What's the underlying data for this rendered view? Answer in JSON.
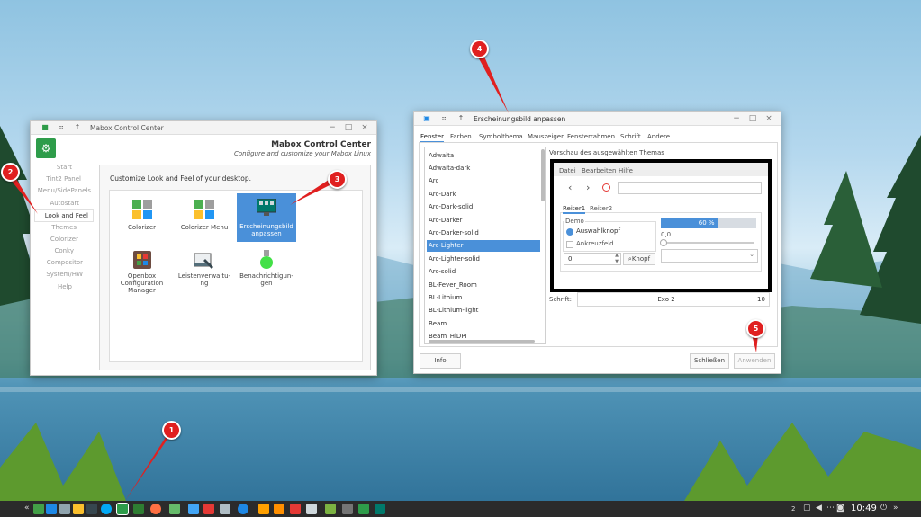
{
  "colors": {
    "accent": "#4a90d9",
    "marker": "#e02020",
    "taskbar": "#2b2b2b"
  },
  "mcc": {
    "title": "Mabox Control Center",
    "header_title": "Mabox Control Center",
    "header_subtitle": "Configure and customize your Mabox Linux",
    "sidebar": [
      "Start",
      "Tint2 Panel",
      "Menu/SidePanels",
      "Autostart",
      "Look and Feel",
      "Themes",
      "Colorizer",
      "Conky",
      "Compositor",
      "System/HW",
      "Help"
    ],
    "content_heading": "Customize Look and Feel of your desktop.",
    "tiles": [
      {
        "label": "Colorizer",
        "icon": "colorizer-icon"
      },
      {
        "label": "Colorizer Menu",
        "icon": "colorizer-menu-icon"
      },
      {
        "label": "Erscheinungsbild anpassen",
        "line1": "Erscheinungsbild",
        "line2": "anpassen",
        "icon": "appearance-icon"
      },
      {
        "label": "Openbox Configuration Manager",
        "line1": "Openbox",
        "line2": "Configuration",
        "line3": "Manager",
        "icon": "openbox-icon"
      },
      {
        "label": "Leistenverwaltung",
        "line1": "Leistenverwaltu-",
        "line2": "ng",
        "icon": "panel-manager-icon"
      },
      {
        "label": "Benachrichtigungen",
        "line1": "Benachrichtigun-",
        "line2": "gen",
        "icon": "notification-icon"
      }
    ],
    "window_controls": {
      "minimize": "−",
      "maximize": "□",
      "close": "×"
    }
  },
  "lx": {
    "title": "Erscheinungsbild anpassen",
    "tabs": [
      "Fenster",
      "Farben",
      "Symbolthema",
      "Mauszeiger",
      "Fensterrahmen",
      "Schrift",
      "Andere"
    ],
    "themes": [
      "Adwaita",
      "Adwaita-dark",
      "Arc",
      "Arc-Dark",
      "Arc-Dark-solid",
      "Arc-Darker",
      "Arc-Darker-solid",
      "Arc-Lighter",
      "Arc-Lighter-solid",
      "Arc-solid",
      "BL-Fever_Room",
      "BL-Lithium",
      "BL-Lithium-light",
      "Beam",
      "Beam_HiDPI"
    ],
    "selected_theme": "Arc-Lighter",
    "preview_label": "Vorschau des ausgewählten Themas",
    "preview": {
      "menu": [
        "Datei",
        "Bearbeiten",
        "Hilfe"
      ],
      "tabs": [
        "Reiter1",
        "Reiter2"
      ],
      "group_label": "Demo",
      "radio_label": "Auswahlknopf",
      "check_label": "Ankreuzfeld",
      "spin_value": "0",
      "button_label": "Knopf",
      "progress_text": "60 %",
      "progress": 0.6,
      "slider_value": "0,0"
    },
    "font_label": "Schrift:",
    "font_name": "Exo 2",
    "font_size": "10",
    "info_button": "Info",
    "close_button": "Schließen",
    "apply_button": "Anwenden"
  },
  "markers": [
    "1",
    "2",
    "3",
    "4",
    "5"
  ],
  "taskbar": {
    "clock": "10:49",
    "desk_num": "2"
  }
}
